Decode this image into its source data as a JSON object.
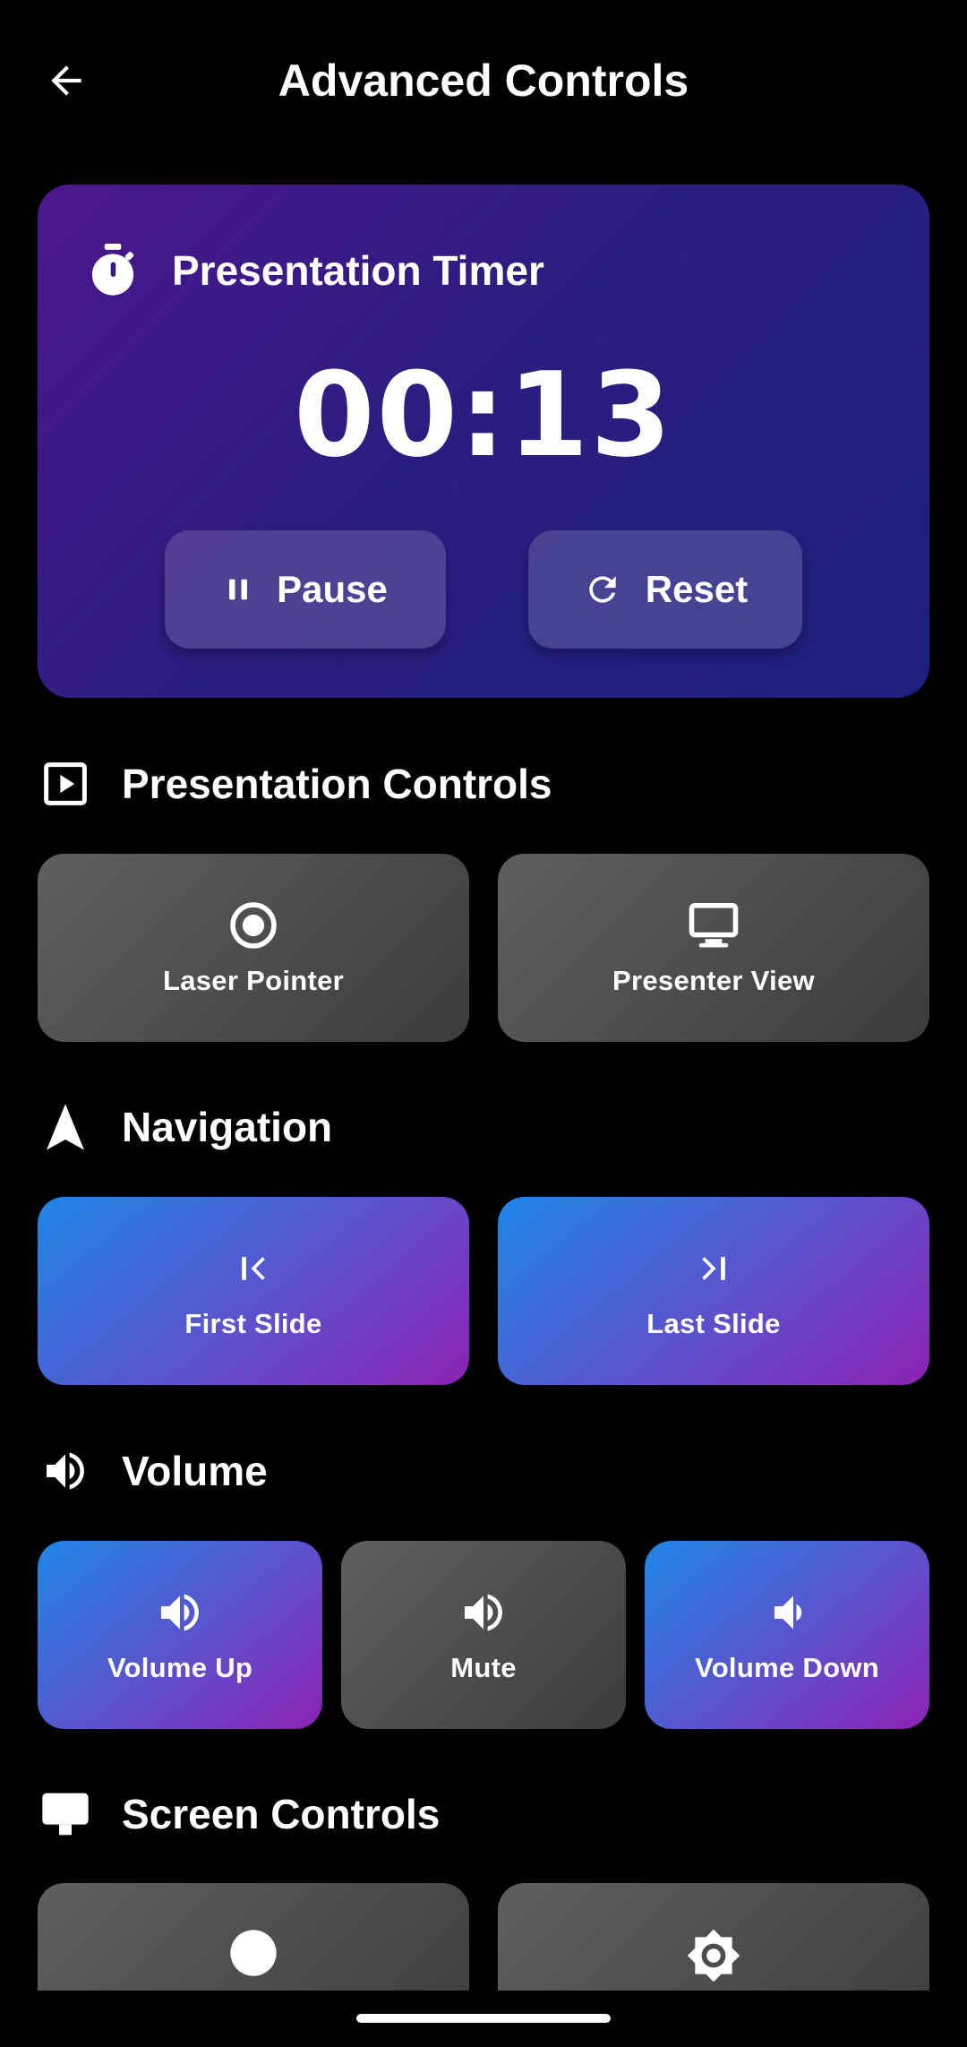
{
  "header": {
    "title": "Advanced Controls",
    "back_icon": "arrow-back-icon"
  },
  "timer": {
    "title": "Presentation Timer",
    "icon": "stopwatch-icon",
    "value": "00:13",
    "pause_label": "Pause",
    "reset_label": "Reset"
  },
  "sections": {
    "presentation": {
      "title": "Presentation Controls",
      "laser": "Laser Pointer",
      "presenter_view": "Presenter View"
    },
    "navigation": {
      "title": "Navigation",
      "first_slide": "First Slide",
      "last_slide": "Last Slide"
    },
    "volume": {
      "title": "Volume",
      "up": "Volume Up",
      "mute": "Mute",
      "down": "Volume Down"
    },
    "screen": {
      "title": "Screen Controls"
    }
  },
  "colors": {
    "background": "#000000",
    "timer_gradient": [
      "#4c178e",
      "#1d2080"
    ],
    "tile_gray": [
      "#5f5f5f",
      "#3c3c3c"
    ],
    "tile_accent": [
      "#1f86e6",
      "#8c22b4"
    ]
  }
}
